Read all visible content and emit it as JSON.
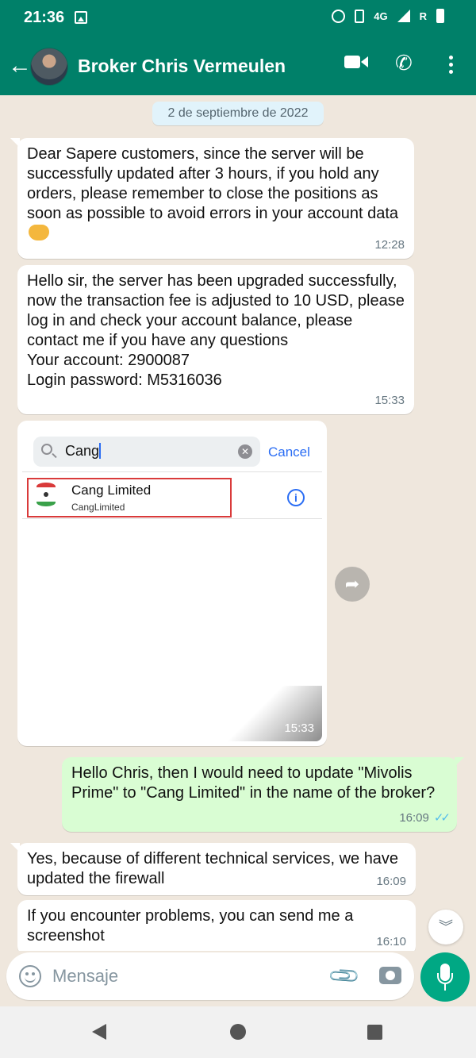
{
  "status_bar": {
    "time": "21:36",
    "network": "4G",
    "roaming": "R"
  },
  "header": {
    "contact_name": "Broker Chris Vermeulen"
  },
  "chat": {
    "date_chip": "2 de septiembre de 2022",
    "messages": [
      {
        "direction": "in",
        "text": "Dear Sapere customers, since the server will be successfully updated after 3 hours, if you hold any orders, please remember to close the positions as soon as possible to avoid errors in your account data",
        "emoji": "handshake",
        "time": "12:28"
      },
      {
        "direction": "in",
        "text": "Hello sir, the server has been upgraded successfully, now the transaction fee is adjusted to 10 USD, please log in and check your account balance, please contact me if you have any questions\nYour account: 2900087\nLogin password: M5316036",
        "time": "15:33"
      },
      {
        "direction": "in",
        "type": "image",
        "time": "15:33",
        "image": {
          "search_query": "Cang",
          "cancel_label": "Cancel",
          "result_name": "Cang Limited",
          "result_subtitle": "CangLimited"
        }
      },
      {
        "direction": "out",
        "text": "Hello Chris, then I would need to update \"Mivolis Prime\" to \"Cang Limited\" in the name of the broker?",
        "time": "16:09",
        "status": "read"
      },
      {
        "direction": "in",
        "text": "Yes, because of different technical services, we have updated the firewall",
        "time": "16:09"
      },
      {
        "direction": "in",
        "text": "If you encounter problems, you can send me a screenshot",
        "time": "16:10"
      }
    ]
  },
  "input": {
    "placeholder": "Mensaje"
  },
  "colors": {
    "header": "#008069",
    "outgoing_bubble": "#d9fdd3",
    "incoming_bubble": "#ffffff",
    "chat_background": "#efe7dd",
    "mic_button": "#00a884",
    "read_ticks": "#53bdeb"
  }
}
